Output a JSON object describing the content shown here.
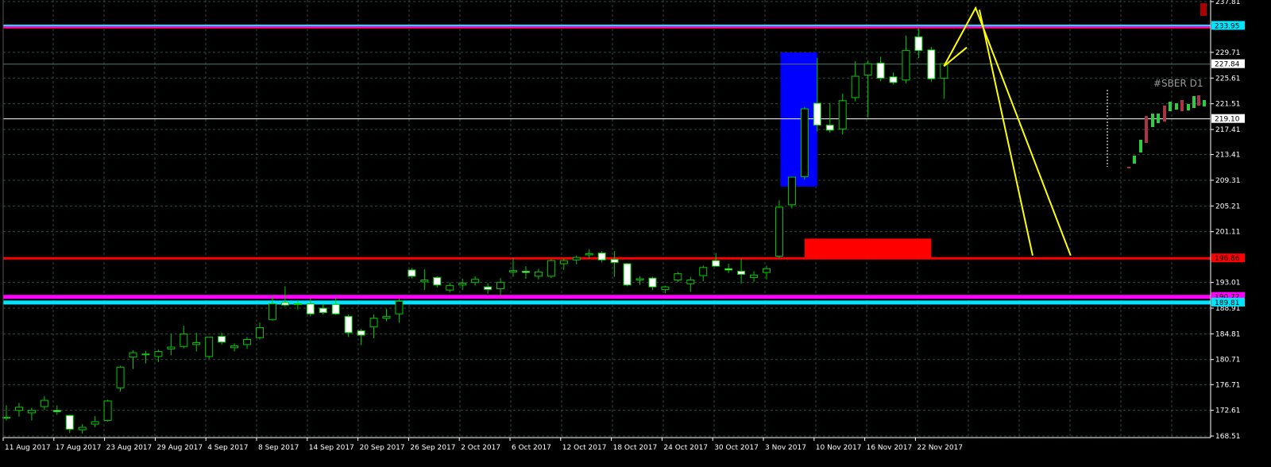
{
  "chart_data": {
    "type": "candlestick",
    "symbol_label": "#SBER D1",
    "colors": {
      "background": "#000000",
      "grid": "#2e4d3a",
      "axis": "#ffffff",
      "bull_body": "#000000",
      "bear_body": "#ffffff",
      "wick": "#00cc00",
      "red_line": "#ff0000",
      "magenta_line": "#ff00ff",
      "cyan_line": "#00e5ff",
      "yellow_line": "#ffff00",
      "blue_zone": "#0000ff",
      "red_zone": "#ff0000"
    },
    "y_axis": {
      "min": 168.51,
      "max": 237.81,
      "ticks": [
        "237.81",
        "229.71",
        "225.61",
        "221.51",
        "217.41",
        "213.41",
        "209.31",
        "205.21",
        "201.11",
        "193.01",
        "188.91",
        "184.81",
        "180.71",
        "176.71",
        "172.61",
        "168.51"
      ]
    },
    "x_axis": {
      "labels": [
        "11 Aug 2017",
        "17 Aug 2017",
        "23 Aug 2017",
        "29 Aug 2017",
        "4 Sep 2017",
        "8 Sep 2017",
        "14 Sep 2017",
        "20 Sep 2017",
        "26 Sep 2017",
        "2 Oct 2017",
        "6 Oct 2017",
        "12 Oct 2017",
        "18 Oct 2017",
        "24 Oct 2017",
        "30 Oct 2017",
        "3 Nov 2017",
        "10 Nov 2017",
        "16 Nov 2017",
        "22 Nov 2017"
      ],
      "label_index": [
        0,
        4,
        8,
        12,
        16,
        20,
        24,
        28,
        32,
        36,
        40,
        44,
        48,
        52,
        56,
        60,
        64,
        68,
        72
      ]
    },
    "price_tags": [
      {
        "value": 233.95,
        "text": "233.95",
        "color": "#00e5ff"
      },
      {
        "value": 227.84,
        "text": "227.84",
        "color": "#ffffff"
      },
      {
        "value": 219.1,
        "text": "219.10",
        "color": "#ffffff"
      },
      {
        "value": 196.86,
        "text": "196.86",
        "color": "#ff0000"
      },
      {
        "value": 190.72,
        "text": "190.72",
        "color": "#ff00ff"
      },
      {
        "value": 189.81,
        "text": "189.81",
        "color": "#00e5ff"
      }
    ],
    "horizontal_lines": [
      {
        "value": 233.95,
        "color": "#00e5ff",
        "width": 3
      },
      {
        "value": 233.75,
        "color": "#ff00ff",
        "width": 2
      },
      {
        "value": 233.55,
        "color": "#ff0000",
        "width": 1
      },
      {
        "value": 196.86,
        "color": "#ff0000",
        "width": 3
      },
      {
        "value": 190.72,
        "color": "#ff00ff",
        "width": 5
      },
      {
        "value": 189.81,
        "color": "#00e5ff",
        "width": 5
      },
      {
        "value": 227.84,
        "color": "#5a7a6a",
        "width": 1
      },
      {
        "value": 219.1,
        "color": "#ffffff",
        "width": 1
      }
    ],
    "zones": [
      {
        "i0": 61.1,
        "i1": 64.0,
        "y0": 208.3,
        "y1": 229.7,
        "color": "#0000ff"
      },
      {
        "i0": 63.0,
        "i1": 73.0,
        "y0": 197.0,
        "y1": 200.0,
        "color": "#ff0000"
      }
    ],
    "yellow_path_a": [
      [
        74.0,
        227.5
      ],
      [
        76.5,
        236.8
      ],
      [
        84.0,
        197.3
      ]
    ],
    "yellow_path_b": [
      [
        74.0,
        227.5
      ],
      [
        75.8,
        230.5
      ]
    ],
    "yellow_path_c": [
      [
        76.8,
        236.5
      ],
      [
        81.0,
        197.3
      ]
    ],
    "candles": [
      {
        "o": 171.5,
        "h": 173.4,
        "l": 171.0,
        "c": 171.5
      },
      {
        "o": 172.6,
        "h": 173.8,
        "l": 171.6,
        "c": 173.1
      },
      {
        "o": 172.2,
        "h": 173.0,
        "l": 171.0,
        "c": 172.6
      },
      {
        "o": 173.2,
        "h": 174.9,
        "l": 172.7,
        "c": 174.2
      },
      {
        "o": 172.6,
        "h": 173.4,
        "l": 171.9,
        "c": 172.4
      },
      {
        "o": 171.8,
        "h": 171.9,
        "l": 169.0,
        "c": 169.6
      },
      {
        "o": 169.5,
        "h": 170.4,
        "l": 168.9,
        "c": 169.9
      },
      {
        "o": 170.4,
        "h": 171.7,
        "l": 169.9,
        "c": 170.8
      },
      {
        "o": 171.0,
        "h": 174.3,
        "l": 170.8,
        "c": 174.1
      },
      {
        "o": 176.2,
        "h": 179.7,
        "l": 175.6,
        "c": 179.5
      },
      {
        "o": 181.1,
        "h": 182.2,
        "l": 179.2,
        "c": 181.8
      },
      {
        "o": 181.6,
        "h": 182.1,
        "l": 180.1,
        "c": 181.6
      },
      {
        "o": 181.2,
        "h": 182.3,
        "l": 180.3,
        "c": 182.0
      },
      {
        "o": 182.4,
        "h": 184.8,
        "l": 181.4,
        "c": 182.7
      },
      {
        "o": 182.8,
        "h": 186.1,
        "l": 182.5,
        "c": 184.8
      },
      {
        "o": 183.1,
        "h": 185.0,
        "l": 182.0,
        "c": 183.4
      },
      {
        "o": 181.2,
        "h": 184.3,
        "l": 180.8,
        "c": 184.3
      },
      {
        "o": 184.4,
        "h": 185.0,
        "l": 183.1,
        "c": 183.5
      },
      {
        "o": 182.6,
        "h": 183.3,
        "l": 182.0,
        "c": 182.9
      },
      {
        "o": 183.1,
        "h": 184.3,
        "l": 182.4,
        "c": 183.9
      },
      {
        "o": 184.2,
        "h": 186.6,
        "l": 183.9,
        "c": 185.8
      },
      {
        "o": 187.1,
        "h": 190.8,
        "l": 186.9,
        "c": 189.6
      },
      {
        "o": 189.8,
        "h": 192.4,
        "l": 189.2,
        "c": 189.4
      },
      {
        "o": 189.6,
        "h": 190.2,
        "l": 188.7,
        "c": 189.5
      },
      {
        "o": 189.6,
        "h": 190.5,
        "l": 187.6,
        "c": 188.0
      },
      {
        "o": 188.9,
        "h": 189.6,
        "l": 187.9,
        "c": 188.2
      },
      {
        "o": 189.5,
        "h": 190.6,
        "l": 187.8,
        "c": 188.0
      },
      {
        "o": 187.6,
        "h": 187.9,
        "l": 184.3,
        "c": 185.0
      },
      {
        "o": 185.3,
        "h": 185.6,
        "l": 183.0,
        "c": 184.6
      },
      {
        "o": 185.9,
        "h": 187.9,
        "l": 184.1,
        "c": 187.3
      },
      {
        "o": 187.3,
        "h": 188.8,
        "l": 186.8,
        "c": 187.6
      },
      {
        "o": 188.0,
        "h": 190.4,
        "l": 186.6,
        "c": 190.0
      },
      {
        "o": 195.0,
        "h": 195.3,
        "l": 193.7,
        "c": 194.0
      },
      {
        "o": 193.1,
        "h": 195.1,
        "l": 191.8,
        "c": 193.4
      },
      {
        "o": 193.8,
        "h": 194.0,
        "l": 192.2,
        "c": 192.6
      },
      {
        "o": 191.8,
        "h": 193.0,
        "l": 191.4,
        "c": 192.5
      },
      {
        "o": 192.6,
        "h": 193.6,
        "l": 191.8,
        "c": 192.9
      },
      {
        "o": 193.0,
        "h": 194.0,
        "l": 192.5,
        "c": 193.5
      },
      {
        "o": 192.3,
        "h": 192.9,
        "l": 191.2,
        "c": 191.9
      },
      {
        "o": 192.0,
        "h": 193.7,
        "l": 190.8,
        "c": 193.0
      },
      {
        "o": 194.7,
        "h": 196.9,
        "l": 193.9,
        "c": 194.9
      },
      {
        "o": 194.8,
        "h": 195.6,
        "l": 193.6,
        "c": 194.6
      },
      {
        "o": 194.0,
        "h": 195.2,
        "l": 193.5,
        "c": 194.7
      },
      {
        "o": 194.0,
        "h": 196.7,
        "l": 193.7,
        "c": 196.5
      },
      {
        "o": 196.0,
        "h": 196.8,
        "l": 195.0,
        "c": 196.5
      },
      {
        "o": 196.6,
        "h": 197.3,
        "l": 195.9,
        "c": 197.0
      },
      {
        "o": 197.4,
        "h": 198.3,
        "l": 196.8,
        "c": 197.6
      },
      {
        "o": 197.7,
        "h": 198.0,
        "l": 196.2,
        "c": 196.6
      },
      {
        "o": 196.7,
        "h": 198.0,
        "l": 193.9,
        "c": 196.2
      },
      {
        "o": 196.0,
        "h": 196.1,
        "l": 192.4,
        "c": 192.6
      },
      {
        "o": 193.4,
        "h": 194.0,
        "l": 192.6,
        "c": 193.6
      },
      {
        "o": 193.7,
        "h": 193.9,
        "l": 191.8,
        "c": 192.3
      },
      {
        "o": 191.9,
        "h": 192.5,
        "l": 191.3,
        "c": 192.3
      },
      {
        "o": 193.4,
        "h": 194.7,
        "l": 193.1,
        "c": 194.4
      },
      {
        "o": 192.8,
        "h": 193.9,
        "l": 191.5,
        "c": 193.4
      },
      {
        "o": 194.1,
        "h": 195.7,
        "l": 193.2,
        "c": 195.4
      },
      {
        "o": 196.5,
        "h": 197.7,
        "l": 195.6,
        "c": 195.6
      },
      {
        "o": 195.2,
        "h": 196.0,
        "l": 194.5,
        "c": 195.0
      },
      {
        "o": 194.8,
        "h": 196.8,
        "l": 192.8,
        "c": 194.3
      },
      {
        "o": 193.8,
        "h": 194.8,
        "l": 193.1,
        "c": 194.2
      },
      {
        "o": 194.6,
        "h": 195.7,
        "l": 193.5,
        "c": 195.2
      },
      {
        "o": 197.2,
        "h": 206.1,
        "l": 196.9,
        "c": 205.0
      },
      {
        "o": 205.4,
        "h": 209.8,
        "l": 204.8,
        "c": 209.8
      },
      {
        "o": 209.9,
        "h": 221.0,
        "l": 209.4,
        "c": 220.7
      },
      {
        "o": 221.6,
        "h": 228.8,
        "l": 217.1,
        "c": 218.1
      },
      {
        "o": 218.1,
        "h": 221.6,
        "l": 216.9,
        "c": 217.3
      },
      {
        "o": 217.5,
        "h": 223.1,
        "l": 216.6,
        "c": 222.0
      },
      {
        "o": 222.5,
        "h": 228.3,
        "l": 221.9,
        "c": 225.9
      },
      {
        "o": 226.1,
        "h": 228.4,
        "l": 219.3,
        "c": 227.9
      },
      {
        "o": 228.0,
        "h": 229.0,
        "l": 225.1,
        "c": 225.6
      },
      {
        "o": 225.8,
        "h": 226.5,
        "l": 224.6,
        "c": 224.9
      },
      {
        "o": 225.3,
        "h": 232.4,
        "l": 224.8,
        "c": 230.0
      },
      {
        "o": 232.2,
        "h": 233.6,
        "l": 228.8,
        "c": 230.0
      },
      {
        "o": 230.1,
        "h": 230.6,
        "l": 225.0,
        "c": 225.5
      },
      {
        "o": 225.6,
        "h": 228.0,
        "l": 222.3,
        "c": 227.9
      }
    ]
  }
}
